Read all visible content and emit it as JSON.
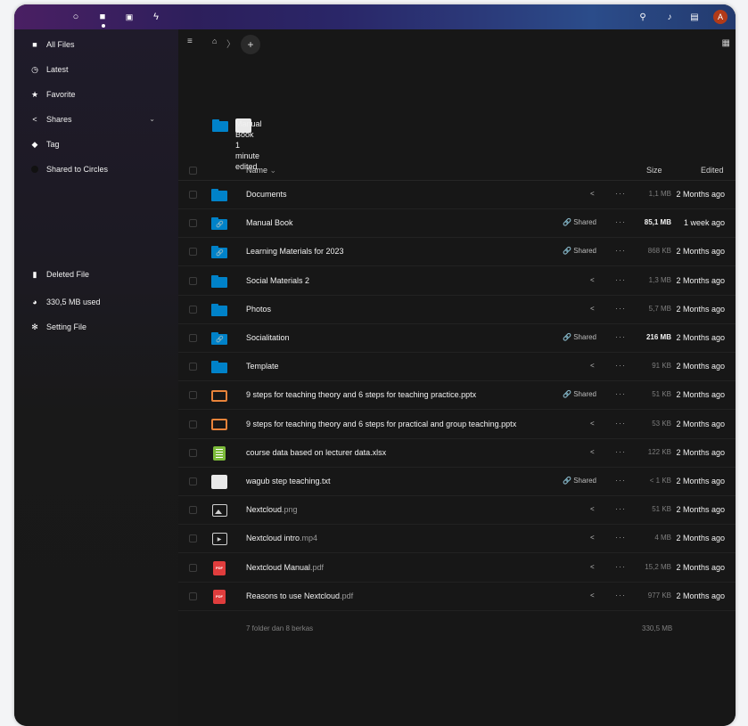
{
  "topbar": {
    "apps": [
      "dashboard-icon",
      "files-icon",
      "photos-icon",
      "activity-icon"
    ],
    "avatar_letter": "A"
  },
  "sidebar": {
    "items": [
      {
        "label": "All Files",
        "icon": "folder-icon"
      },
      {
        "label": "Latest",
        "icon": "clock-icon"
      },
      {
        "label": "Favorite",
        "icon": "star-icon"
      },
      {
        "label": "Shares",
        "icon": "share-icon"
      },
      {
        "label": "Tag",
        "icon": "tag-icon"
      },
      {
        "label": "Shared to Circles",
        "icon": "circles-icon"
      }
    ],
    "bottom": [
      {
        "label": "Deleted File",
        "icon": "trash-icon"
      },
      {
        "label": "330,5 MB used",
        "icon": "pie-chart-icon"
      },
      {
        "label": "Setting File",
        "icon": "gear-icon"
      }
    ]
  },
  "recent": {
    "name": "Manual Book",
    "sub": "1 minute edited"
  },
  "table": {
    "headers": {
      "name": "Name",
      "name_sort": "⌄",
      "size": "Size",
      "edited": "Edited"
    },
    "rows": [
      {
        "name": "Documents",
        "ext": "",
        "type": "folder",
        "share": "",
        "size": "1,1 MB",
        "size_strong": false,
        "edited": "2 Months ago"
      },
      {
        "name": "Manual Book",
        "ext": "",
        "type": "shared-folder",
        "share": "Shared",
        "size": "85,1 MB",
        "size_strong": true,
        "edited": "1 week ago"
      },
      {
        "name": "Learning Materials for 2023",
        "ext": "",
        "type": "shared-folder",
        "share": "Shared",
        "size": "868 KB",
        "size_strong": false,
        "edited": "2 Months ago"
      },
      {
        "name": "Social Materials 2",
        "ext": "",
        "type": "folder",
        "share": "",
        "size": "1,3 MB",
        "size_strong": false,
        "edited": "2 Months ago"
      },
      {
        "name": "Photos",
        "ext": "",
        "type": "folder",
        "share": "",
        "size": "5,7 MB",
        "size_strong": false,
        "edited": "2 Months ago"
      },
      {
        "name": "Socialitation",
        "ext": "",
        "type": "shared-folder",
        "share": "Shared",
        "size": "216 MB",
        "size_strong": true,
        "edited": "2 Months ago"
      },
      {
        "name": "Template",
        "ext": "",
        "type": "folder",
        "share": "",
        "size": "91 KB",
        "size_strong": false,
        "edited": "2 Months ago"
      },
      {
        "name": "9 steps for teaching theory and 6 steps for teaching practice.pptx",
        "ext": "",
        "type": "pptx",
        "share": "Shared",
        "size": "51 KB",
        "size_strong": false,
        "edited": "2 Months ago"
      },
      {
        "name": "9 steps for teaching theory and 6 steps for practical and group teaching.pptx",
        "ext": "",
        "type": "pptx",
        "share": "",
        "size": "53 KB",
        "size_strong": false,
        "edited": "2 Months ago"
      },
      {
        "name": "course data based on lecturer data.xlsx",
        "ext": "",
        "type": "xlsx",
        "share": "",
        "size": "122 KB",
        "size_strong": false,
        "edited": "2 Months ago"
      },
      {
        "name": "wagub step teaching.txt",
        "ext": "",
        "type": "txt",
        "share": "Shared",
        "size": "< 1 KB",
        "size_strong": false,
        "edited": "2 Months ago"
      },
      {
        "name": "Nextcloud",
        "ext": ".png",
        "type": "image",
        "share": "",
        "size": "51 KB",
        "size_strong": false,
        "edited": "2 Months ago"
      },
      {
        "name": "Nextcloud intro",
        "ext": ".mp4",
        "type": "video",
        "share": "",
        "size": "4 MB",
        "size_strong": false,
        "edited": "2 Months ago"
      },
      {
        "name": "Nextcloud Manual",
        "ext": ".pdf",
        "type": "pdf",
        "share": "",
        "size": "15,2 MB",
        "size_strong": false,
        "edited": "2 Months ago"
      },
      {
        "name": "Reasons to use Nextcloud",
        "ext": ".pdf",
        "type": "pdf",
        "share": "",
        "size": "977 KB",
        "size_strong": false,
        "edited": "2 Months ago"
      }
    ],
    "footer": {
      "summary": "7 folder dan 8 berkas",
      "total": "330,5 MB"
    }
  },
  "colors": {
    "accent": "#0082c9",
    "background": "#171717"
  }
}
